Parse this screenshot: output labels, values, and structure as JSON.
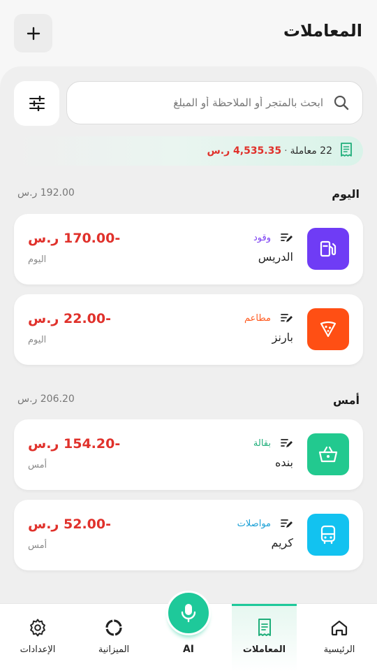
{
  "header": {
    "title": "المعاملات"
  },
  "search": {
    "placeholder": "ابحث بالمتجر أو الملاحظة أو المبلغ"
  },
  "summary": {
    "count": "22 معاملة",
    "separator": "·",
    "total": "4,535.35 ر.س"
  },
  "groups": [
    {
      "title": "اليوم",
      "total": "192.00 ر.س",
      "items": [
        {
          "category": "وقود",
          "category_color": "#7b3ff2",
          "icon": "fuel-pump-icon",
          "icon_bg": "#6f3cf5",
          "merchant": "الدريس",
          "amount": "-170.00 ر.س",
          "date": "اليوم"
        },
        {
          "category": "مطاعم",
          "category_color": "#ff5a1f",
          "icon": "pizza-slice-icon",
          "icon_bg": "#ff4f14",
          "merchant": "بارنز",
          "amount": "-22.00 ر.س",
          "date": "اليوم"
        }
      ]
    },
    {
      "title": "أمس",
      "total": "206.20 ر.س",
      "items": [
        {
          "category": "بقالة",
          "category_color": "#1fae7a",
          "icon": "basket-icon",
          "icon_bg": "#22c98f",
          "merchant": "بنده",
          "amount": "-154.20 ر.س",
          "date": "أمس"
        },
        {
          "category": "مواصلات",
          "category_color": "#1aa0d6",
          "icon": "bus-icon",
          "icon_bg": "#12c2f0",
          "merchant": "كريم",
          "amount": "-52.00 ر.س",
          "date": "أمس"
        }
      ]
    }
  ],
  "tabs": [
    {
      "label": "الرئيسية",
      "icon": "home-icon"
    },
    {
      "label": "المعاملات",
      "icon": "receipt-icon",
      "active": true
    },
    {
      "label": "AI",
      "icon": "microphone-icon"
    },
    {
      "label": "الميزانية",
      "icon": "donut-chart-icon"
    },
    {
      "label": "الإعدادات",
      "icon": "gear-icon"
    }
  ],
  "colors": {
    "accent": "#1ec99a",
    "negative": "#e0312b"
  }
}
